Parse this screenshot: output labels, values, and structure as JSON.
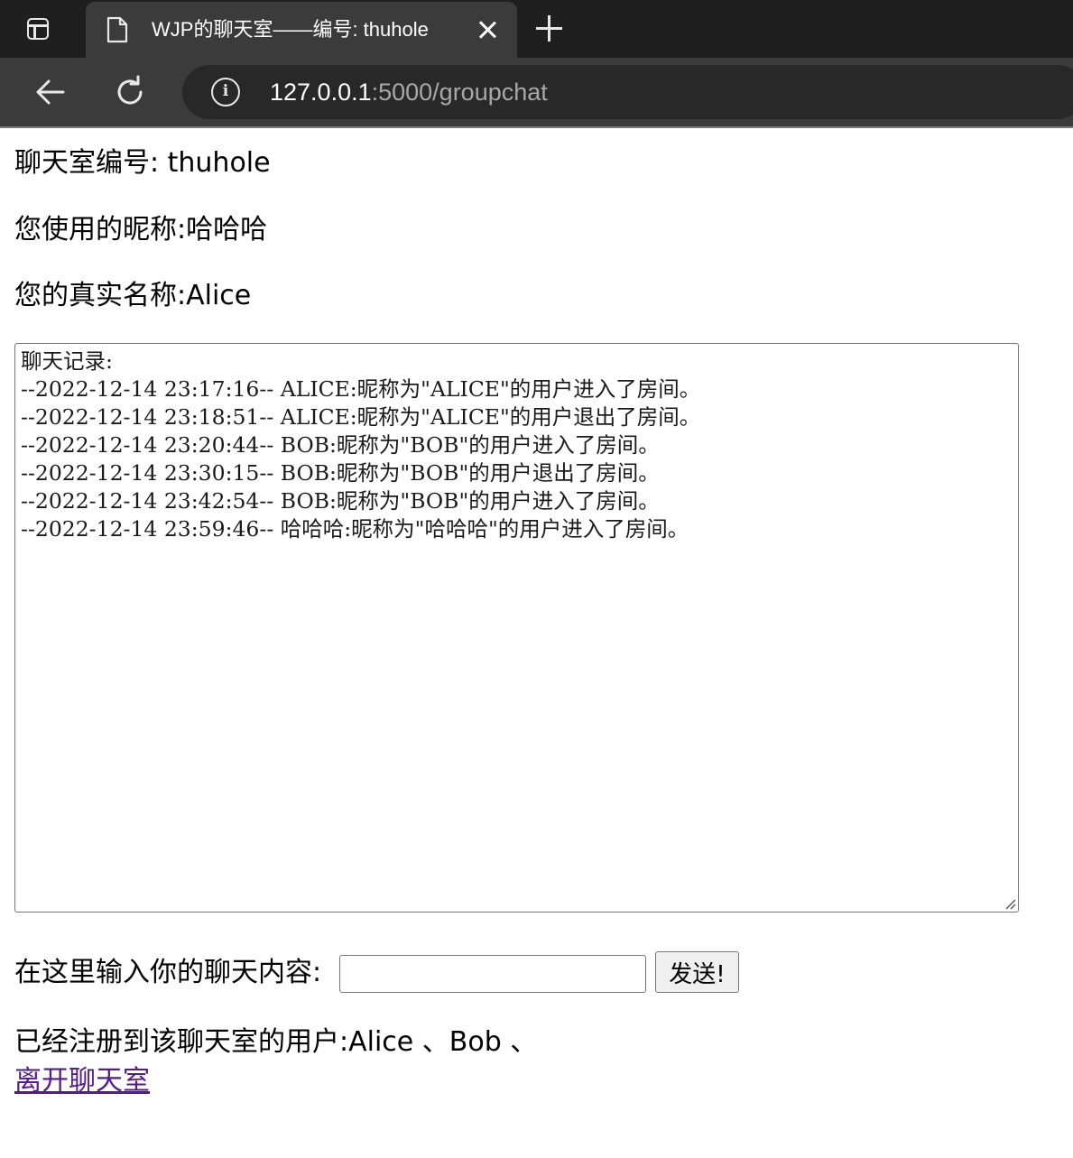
{
  "browser": {
    "tab": {
      "title": "WJP的聊天室——编号: thuhole"
    },
    "address": {
      "host": "127.0.0.1",
      "rest": ":5000/groupchat"
    }
  },
  "page": {
    "room_line": "聊天室编号: thuhole",
    "nickname_line": "您使用的昵称:哈哈哈",
    "realname_line": "您的真实名称:Alice",
    "chat_log": [
      "聊天记录:",
      "--2022-12-14 23:17:16-- ALICE:昵称为\"ALICE\"的用户进入了房间。",
      "--2022-12-14 23:18:51-- ALICE:昵称为\"ALICE\"的用户退出了房间。",
      "--2022-12-14 23:20:44-- BOB:昵称为\"BOB\"的用户进入了房间。",
      "--2022-12-14 23:30:15-- BOB:昵称为\"BOB\"的用户退出了房间。",
      "--2022-12-14 23:42:54-- BOB:昵称为\"BOB\"的用户进入了房间。",
      "--2022-12-14 23:59:46-- 哈哈哈:昵称为\"哈哈哈\"的用户进入了房间。"
    ],
    "message_label": "在这里输入你的聊天内容:",
    "message_value": "",
    "send_label": "发送!",
    "registered_users_line": "已经注册到该聊天室的用户:Alice 、Bob 、",
    "leave_link": "离开聊天室"
  },
  "colors": {
    "tabstrip": "#1f1f1f",
    "toolbar": "#3b3b3b",
    "visited_link": "#551a8b"
  }
}
